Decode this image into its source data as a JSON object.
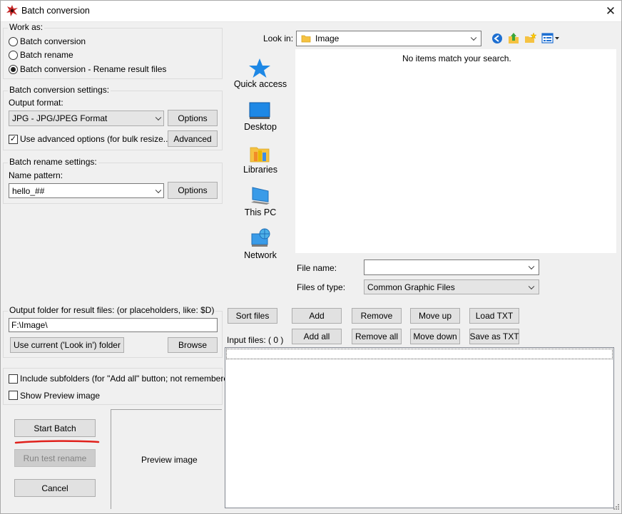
{
  "window": {
    "title": "Batch conversion",
    "close_label": "✕"
  },
  "work_as": {
    "legend": "Work as:",
    "options": [
      {
        "label": "Batch conversion",
        "selected": false
      },
      {
        "label": "Batch rename",
        "selected": false
      },
      {
        "label": "Batch conversion - Rename result files",
        "selected": true
      }
    ]
  },
  "conversion_settings": {
    "legend": "Batch conversion settings:",
    "output_format_label": "Output format:",
    "output_format_value": "JPG - JPG/JPEG Format",
    "options_label": "Options",
    "advanced_checkbox_label": "Use advanced options (for bulk resize...)",
    "advanced_checked": true,
    "advanced_label": "Advanced"
  },
  "rename_settings": {
    "legend": "Batch rename settings:",
    "name_pattern_label": "Name pattern:",
    "name_pattern_value": "hello_##",
    "options_label": "Options"
  },
  "output_folder": {
    "legend": "Output folder for result files: (or placeholders, like: $D)",
    "path": "F:\\Image\\",
    "use_current_label": "Use current ('Look in') folder",
    "browse_label": "Browse"
  },
  "flags": {
    "include_subfolders_label": "Include subfolders (for \"Add all\" button; not remembered)",
    "include_subfolders_checked": false,
    "show_preview_label": "Show Preview image",
    "show_preview_checked": false
  },
  "actions": {
    "start_batch": "Start Batch",
    "run_test_rename": "Run test rename",
    "cancel": "Cancel"
  },
  "preview": {
    "label": "Preview image"
  },
  "browser": {
    "look_in_label": "Look in:",
    "look_in_value": "Image",
    "empty_message": "No items match your search.",
    "places": [
      {
        "label": "Quick access",
        "icon": "star-icon"
      },
      {
        "label": "Desktop",
        "icon": "desktop-icon"
      },
      {
        "label": "Libraries",
        "icon": "libraries-icon"
      },
      {
        "label": "This PC",
        "icon": "computer-icon"
      },
      {
        "label": "Network",
        "icon": "network-icon"
      }
    ],
    "file_name_label": "File name:",
    "file_name_value": "",
    "files_of_type_label": "Files of type:",
    "files_of_type_value": "Common Graphic Files"
  },
  "list_buttons": {
    "sort_files": "Sort files",
    "add": "Add",
    "remove": "Remove",
    "move_up": "Move up",
    "load_txt": "Load TXT",
    "add_all": "Add all",
    "remove_all": "Remove all",
    "move_down": "Move down",
    "save_as_txt": "Save as TXT"
  },
  "input_files": {
    "label": "Input files: ( 0 )"
  },
  "colors": {
    "background": "#f0f0f0",
    "button_face": "#e1e1e1",
    "accent_blue": "#1e88e5",
    "annotation_red": "#e0201b",
    "folder_yellow": "#f5c242"
  }
}
